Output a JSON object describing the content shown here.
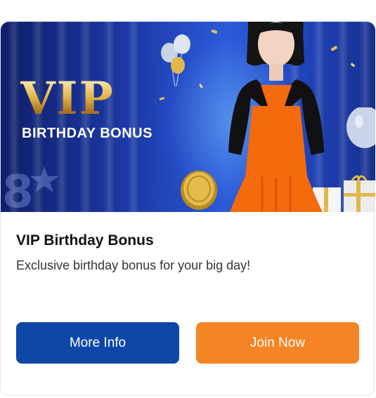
{
  "banner": {
    "vip_text": "VIP",
    "subtitle": "BIRTHDAY BONUS"
  },
  "card": {
    "title": "VIP Birthday Bonus",
    "description": "Exclusive birthday bonus for your big day!"
  },
  "actions": {
    "more_info_label": "More Info",
    "join_now_label": "Join Now"
  },
  "colors": {
    "primary_blue": "#0e47a8",
    "accent_orange": "#f58426",
    "banner_gold": "#e3b64b"
  }
}
